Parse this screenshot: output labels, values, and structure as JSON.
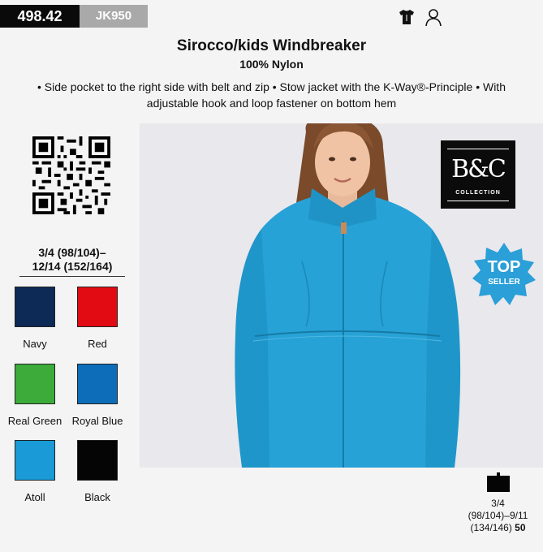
{
  "header": {
    "price_code": "498.42",
    "article_code": "JK950",
    "icons": [
      "tshirt-icon",
      "person-icon"
    ]
  },
  "product": {
    "title": "Sirocco/kids Windbreaker",
    "material": "100% Nylon",
    "description": "• Side pocket to the right side with belt and zip • Stow jacket with the K-Way®-Principle • With adjustable hook and loop fastener on bottom hem"
  },
  "sizes": {
    "line1": "3/4 (98/104)–",
    "line2": "12/14 (152/164)"
  },
  "colors": [
    {
      "name": "Navy",
      "hex": "#0d2a57"
    },
    {
      "name": "Red",
      "hex": "#e20b13"
    },
    {
      "name": "Real Green",
      "hex": "#3cab3a"
    },
    {
      "name": "Royal Blue",
      "hex": "#0d6db8"
    },
    {
      "name": "Atoll",
      "hex": "#1a9ad6"
    },
    {
      "name": "Black",
      "hex": "#050505"
    }
  ],
  "brand": {
    "mark": "B&C",
    "word": "COLLECTION"
  },
  "badge": {
    "line1": "TOP",
    "line2": "SELLER",
    "color": "#2a9fd8"
  },
  "packaging": {
    "line1": "3/4",
    "line2": "(98/104)–9/11",
    "line3": "(134/146)",
    "quantity": "50"
  }
}
